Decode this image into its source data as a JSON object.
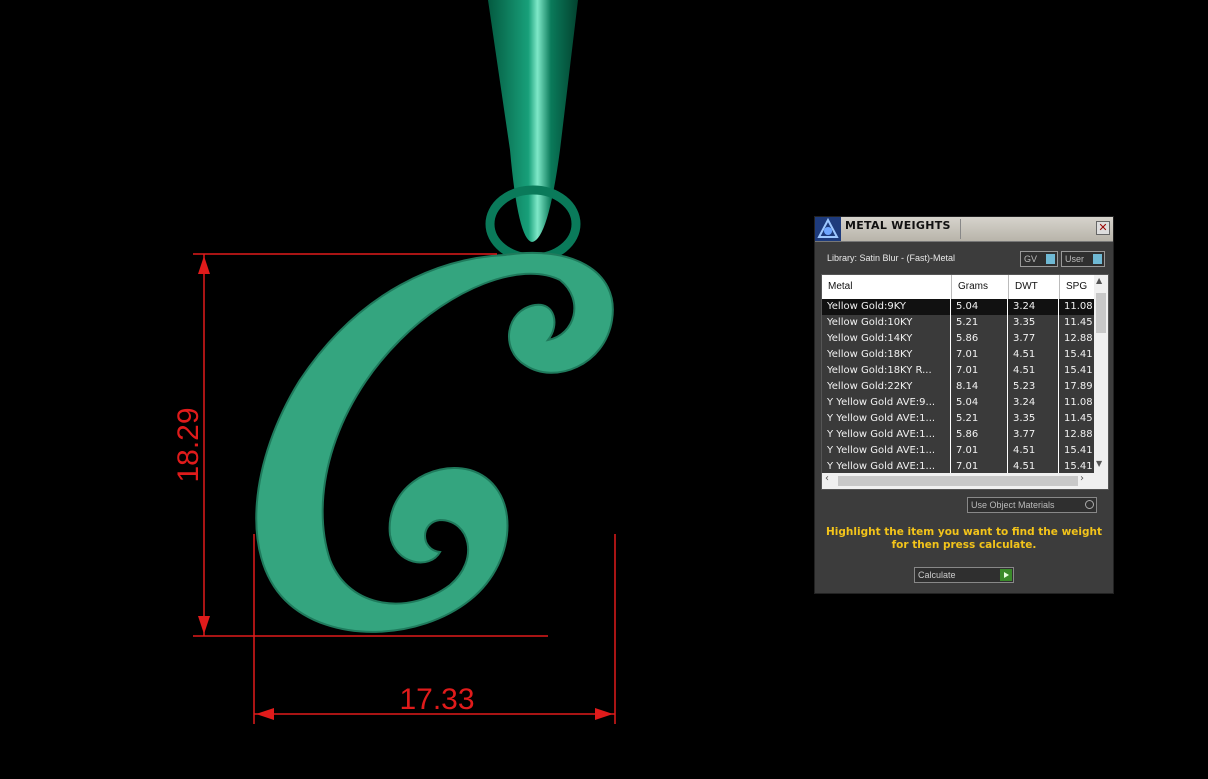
{
  "dimensions": {
    "height_label": "18.29",
    "width_label": "17.33",
    "color": "#e01b1b"
  },
  "model": {
    "fill_color": "#34a57f",
    "bail_color": "#0a7a5a"
  },
  "panel": {
    "title": "METAL WEIGHTS",
    "close_icon": "close-icon",
    "library_label": "Library: Satin Blur - (Fast)-Metal",
    "gv_label": "GV",
    "user_label": "User",
    "columns": [
      "Metal",
      "Grams",
      "DWT",
      "SPG"
    ],
    "rows": [
      {
        "metal": "Yellow Gold:9KY",
        "grams": "5.04",
        "dwt": "3.24",
        "spg": "11.08"
      },
      {
        "metal": "Yellow Gold:10KY",
        "grams": "5.21",
        "dwt": "3.35",
        "spg": "11.45"
      },
      {
        "metal": "Yellow Gold:14KY",
        "grams": "5.86",
        "dwt": "3.77",
        "spg": "12.88"
      },
      {
        "metal": "Yellow Gold:18KY",
        "grams": "7.01",
        "dwt": "4.51",
        "spg": "15.41"
      },
      {
        "metal": "Yellow Gold:18KY R...",
        "grams": "7.01",
        "dwt": "4.51",
        "spg": "15.41"
      },
      {
        "metal": "Yellow Gold:22KY",
        "grams": "8.14",
        "dwt": "5.23",
        "spg": "17.89"
      },
      {
        "metal": "Y Yellow Gold AVE:9...",
        "grams": "5.04",
        "dwt": "3.24",
        "spg": "11.08"
      },
      {
        "metal": "Y Yellow Gold AVE:1...",
        "grams": "5.21",
        "dwt": "3.35",
        "spg": "11.45"
      },
      {
        "metal": "Y Yellow Gold AVE:1...",
        "grams": "5.86",
        "dwt": "3.77",
        "spg": "12.88"
      },
      {
        "metal": "Y Yellow Gold AVE:1...",
        "grams": "7.01",
        "dwt": "4.51",
        "spg": "15.41"
      },
      {
        "metal": "Y Yellow Gold AVE:1...",
        "grams": "7.01",
        "dwt": "4.51",
        "spg": "15.41"
      }
    ],
    "use_object_materials": "Use Object Materials",
    "hint": "Highlight the item you want to find the weight for then press calculate.",
    "calculate_label": "Calculate"
  }
}
